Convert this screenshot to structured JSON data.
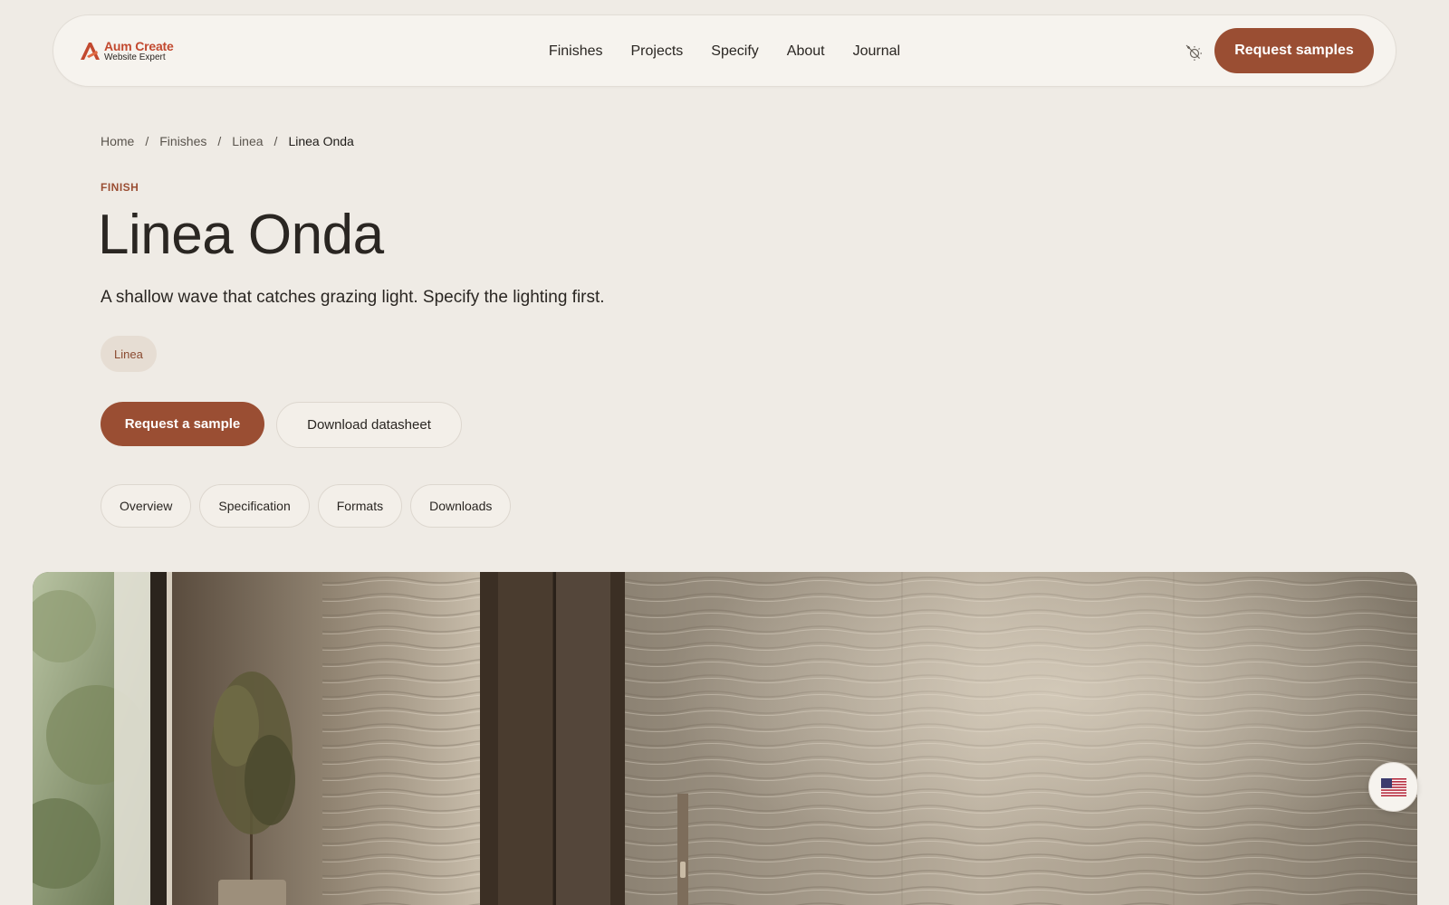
{
  "brand": {
    "name": "Aum Create",
    "tagline": "Website Expert",
    "accent_color": "#9a4e33",
    "logo_color": "#c2492f"
  },
  "nav": {
    "items": [
      "Finishes",
      "Projects",
      "Specify",
      "About",
      "Journal"
    ],
    "theme_toggle_icon": "theme-toggle-icon",
    "cta_label": "Request samples"
  },
  "breadcrumb": {
    "items": [
      "Home",
      "Finishes",
      "Linea"
    ],
    "current": "Linea Onda",
    "separator": "/"
  },
  "product": {
    "eyebrow": "FINISH",
    "title": "Linea Onda",
    "description": "A shallow wave that catches grazing light. Specify the lighting first.",
    "tag": "Linea"
  },
  "actions": {
    "primary_label": "Request a sample",
    "secondary_label": "Download datasheet"
  },
  "tabs": [
    "Overview",
    "Specification",
    "Formats",
    "Downloads"
  ],
  "locale": {
    "icon": "us-flag-icon"
  }
}
